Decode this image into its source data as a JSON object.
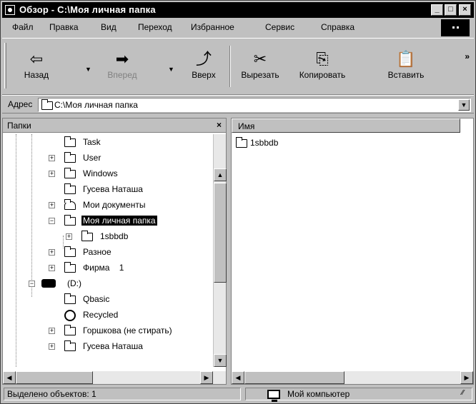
{
  "window": {
    "title": "Обзор - C:\\Моя личная папка",
    "controls": {
      "minimize": "_",
      "maximize": "□",
      "close": "×"
    }
  },
  "menu": {
    "items": [
      {
        "label": "Файл"
      },
      {
        "label": "Правка"
      },
      {
        "label": "Вид"
      },
      {
        "label": "Переход"
      },
      {
        "label": "Избранное"
      },
      {
        "label": "Сервис"
      },
      {
        "label": "Справка"
      }
    ]
  },
  "toolbar": {
    "buttons": [
      {
        "label": "Назад",
        "icon": "back-arrow-icon",
        "glyph": "⇦",
        "enabled": true
      },
      {
        "label": "Вперед",
        "icon": "forward-arrow-icon",
        "glyph": "➡",
        "enabled": false
      },
      {
        "label": "Вверх",
        "icon": "up-folder-icon",
        "glyph": "⤴",
        "enabled": true
      },
      {
        "label": "Вырезать",
        "icon": "scissors-icon",
        "glyph": "✂",
        "enabled": true
      },
      {
        "label": "Копировать",
        "icon": "copy-icon",
        "glyph": "⎘",
        "enabled": true
      },
      {
        "label": "Вставить",
        "icon": "paste-icon",
        "glyph": "📋",
        "enabled": true
      }
    ],
    "overflow": "»"
  },
  "address": {
    "label": "Адрес",
    "value": "C:\\Моя личная папка"
  },
  "folders_panel": {
    "title": "Папки",
    "close": "×",
    "tree": [
      {
        "label": "Task",
        "expander": "",
        "icon": "folder-icon"
      },
      {
        "label": "User",
        "expander": "+",
        "icon": "folder-icon"
      },
      {
        "label": "Windows",
        "expander": "+",
        "icon": "folder-icon"
      },
      {
        "label": "Гусева  Наташа",
        "expander": "",
        "icon": "folder-icon"
      },
      {
        "label": "Мои документы",
        "expander": "+",
        "icon": "my-documents-icon"
      },
      {
        "label": "Моя личная папка",
        "expander": "−",
        "icon": "open-folder-icon",
        "selected": true
      },
      {
        "label": "1sbbdb",
        "expander": "+",
        "icon": "folder-icon"
      },
      {
        "label": "Разное",
        "expander": "+",
        "icon": "folder-icon"
      },
      {
        "label": "Фирма    1",
        "expander": "+",
        "icon": "folder-icon"
      },
      {
        "label": "(D:)",
        "expander": "−",
        "icon": "drive-icon"
      },
      {
        "label": "Qbasic",
        "expander": "",
        "icon": "folder-icon"
      },
      {
        "label": "Recycled",
        "expander": "",
        "icon": "recycle-bin-icon"
      },
      {
        "label": "Горшкова (не стирать)",
        "expander": "+",
        "icon": "folder-icon"
      },
      {
        "label": "Гусева  Наташа",
        "expander": "+",
        "icon": "folder-icon"
      }
    ]
  },
  "files_panel": {
    "column_name": "Имя",
    "items": [
      {
        "label": "1sbbdb",
        "icon": "folder-icon"
      }
    ]
  },
  "status": {
    "selected_text": "Выделено объектов: 1",
    "location": "Мой компьютер"
  }
}
